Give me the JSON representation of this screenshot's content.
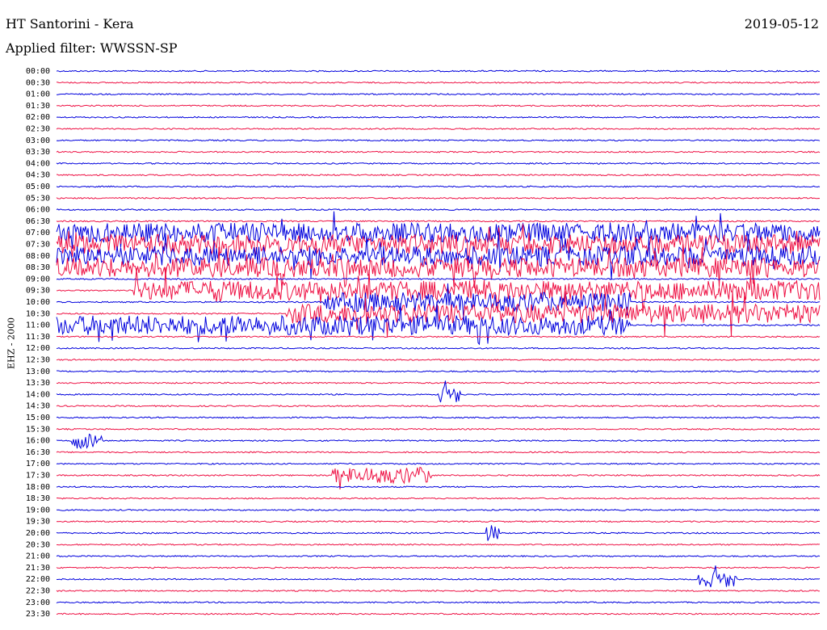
{
  "header": {
    "station": "HT Santorini - Kera",
    "date": "2019-05-12",
    "filter": "Applied filter: WWSSN-SP"
  },
  "channel_label": "EHZ - 2000",
  "colors": {
    "even_trace": "#0000dd",
    "odd_trace": "#ee1144"
  },
  "chart_data": {
    "type": "line",
    "title": "HT Santorini - Kera",
    "ylabel": "EHZ - 2000",
    "row_labels": [
      "00:00",
      "00:30",
      "01:00",
      "01:30",
      "02:00",
      "02:30",
      "03:00",
      "03:30",
      "04:00",
      "04:30",
      "05:00",
      "05:30",
      "06:00",
      "06:30",
      "07:00",
      "07:30",
      "08:00",
      "08:30",
      "09:00",
      "09:30",
      "10:00",
      "10:30",
      "11:00",
      "11:30",
      "12:00",
      "12:30",
      "13:00",
      "13:30",
      "14:00",
      "14:30",
      "15:00",
      "15:30",
      "16:00",
      "16:30",
      "17:00",
      "17:30",
      "18:00",
      "18:30",
      "19:00",
      "19:30",
      "20:00",
      "20:30",
      "21:00",
      "21:30",
      "22:00",
      "22:30",
      "23:00",
      "23:30"
    ],
    "activity_windows": [
      {
        "row": "07:00",
        "from": 0.0,
        "to": 1.0,
        "level": "high"
      },
      {
        "row": "07:30",
        "from": 0.0,
        "to": 1.0,
        "level": "high"
      },
      {
        "row": "08:00",
        "from": 0.0,
        "to": 1.0,
        "level": "high"
      },
      {
        "row": "08:30",
        "from": 0.0,
        "to": 1.0,
        "level": "high"
      },
      {
        "row": "09:30",
        "from": 0.1,
        "to": 1.0,
        "level": "high"
      },
      {
        "row": "10:00",
        "from": 0.35,
        "to": 0.75,
        "level": "high"
      },
      {
        "row": "10:30",
        "from": 0.3,
        "to": 1.0,
        "level": "high"
      },
      {
        "row": "11:00",
        "from": 0.0,
        "to": 0.75,
        "level": "high"
      },
      {
        "row": "14:00",
        "from": 0.5,
        "to": 0.53,
        "level": "event"
      },
      {
        "row": "16:00",
        "from": 0.02,
        "to": 0.06,
        "level": "event"
      },
      {
        "row": "17:30",
        "from": 0.36,
        "to": 0.49,
        "level": "event"
      },
      {
        "row": "20:00",
        "from": 0.56,
        "to": 0.58,
        "level": "event"
      },
      {
        "row": "22:00",
        "from": 0.84,
        "to": 0.89,
        "level": "event"
      }
    ]
  }
}
